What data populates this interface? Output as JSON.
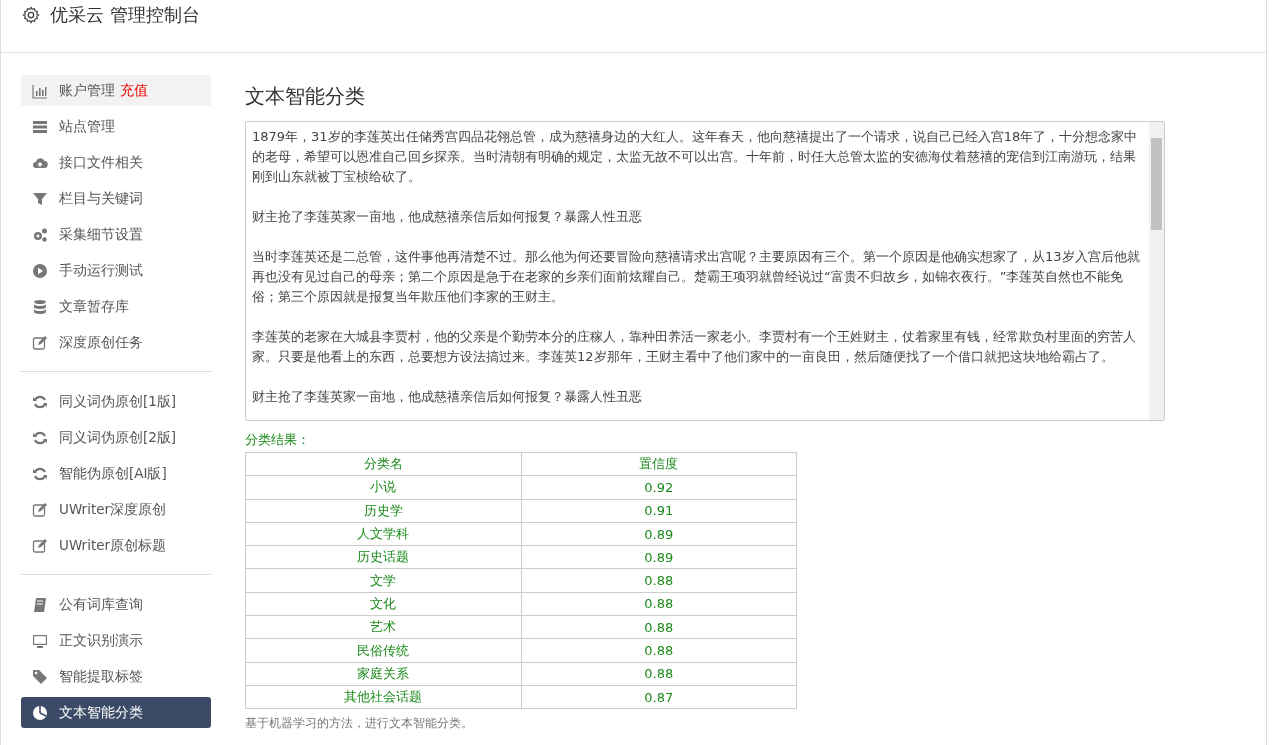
{
  "header": {
    "title": "优采云 管理控制台"
  },
  "sidebar": {
    "groups": [
      [
        {
          "label": "账户管理",
          "badge": "充值",
          "highlighted": true,
          "selected": false
        },
        {
          "label": "站点管理",
          "highlighted": false,
          "selected": false
        },
        {
          "label": "接口文件相关",
          "highlighted": false,
          "selected": false
        },
        {
          "label": "栏目与关键词",
          "highlighted": false,
          "selected": false
        },
        {
          "label": "采集细节设置",
          "highlighted": false,
          "selected": false
        },
        {
          "label": "手动运行测试",
          "highlighted": false,
          "selected": false
        },
        {
          "label": "文章暂存库",
          "highlighted": false,
          "selected": false
        },
        {
          "label": "深度原创任务",
          "highlighted": false,
          "selected": false
        }
      ],
      [
        {
          "label": "同义词伪原创[1版]",
          "highlighted": false,
          "selected": false
        },
        {
          "label": "同义词伪原创[2版]",
          "highlighted": false,
          "selected": false
        },
        {
          "label": "智能伪原创[AI版]",
          "highlighted": false,
          "selected": false
        },
        {
          "label": "UWriter深度原创",
          "highlighted": false,
          "selected": false
        },
        {
          "label": "UWriter原创标题",
          "highlighted": false,
          "selected": false
        }
      ],
      [
        {
          "label": "公有词库查询",
          "highlighted": false,
          "selected": false
        },
        {
          "label": "正文识别演示",
          "highlighted": false,
          "selected": false
        },
        {
          "label": "智能提取标签",
          "highlighted": false,
          "selected": false
        },
        {
          "label": "文本智能分类",
          "highlighted": false,
          "selected": true
        }
      ]
    ]
  },
  "main": {
    "title": "文本智能分类",
    "text_input": {
      "paragraphs": [
        "1879年，31岁的李莲英出任储秀宫四品花翎总管，成为慈禧身边的大红人。这年春天，他向慈禧提出了一个请求，说自己已经入宫18年了，十分想念家中的老母，希望可以恩准自己回乡探亲。当时清朝有明确的规定，太监无故不可以出宫。十年前，时任大总管太监的安德海仗着慈禧的宠信到江南游玩，结果刚到山东就被丁宝桢给砍了。",
        "财主抢了李莲英家一亩地，他成慈禧亲信后如何报复？暴露人性丑恶",
        "当时李莲英还是二总管，这件事他再清楚不过。那么他为何还要冒险向慈禧请求出宫呢？主要原因有三个。第一个原因是他确实想家了，从13岁入宫后他就再也没有见过自己的母亲；第二个原因是急于在老家的乡亲们面前炫耀自己。楚霸王项羽就曾经说过“富贵不归故乡，如锦衣夜行。”李莲英自然也不能免俗；第三个原因就是报复当年欺压他们李家的王财主。",
        "李莲英的老家在大城县李贾村，他的父亲是个勤劳本分的庄稼人，靠种田养活一家老小。李贾村有一个王姓财主，仗着家里有钱，经常欺负村里面的穷苦人家。只要是他看上的东西，总要想方设法搞过来。李莲英12岁那年，王财主看中了他们家中的一亩良田，然后随便找了一个借口就把这块地给霸占了。",
        "财主抢了李莲英家一亩地，他成慈禧亲信后如何报复？暴露人性丑恶"
      ]
    },
    "result_label": "分类结果：",
    "table": {
      "columns": [
        "分类名",
        "置信度"
      ],
      "rows": [
        [
          "小说",
          "0.92"
        ],
        [
          "历史学",
          "0.91"
        ],
        [
          "人文学科",
          "0.89"
        ],
        [
          "历史话题",
          "0.89"
        ],
        [
          "文学",
          "0.88"
        ],
        [
          "文化",
          "0.88"
        ],
        [
          "艺术",
          "0.88"
        ],
        [
          "民俗传统",
          "0.88"
        ],
        [
          "家庭关系",
          "0.88"
        ],
        [
          "其他社会话题",
          "0.87"
        ]
      ]
    },
    "footnote": "基于机器学习的方法，进行文本智能分类。"
  }
}
